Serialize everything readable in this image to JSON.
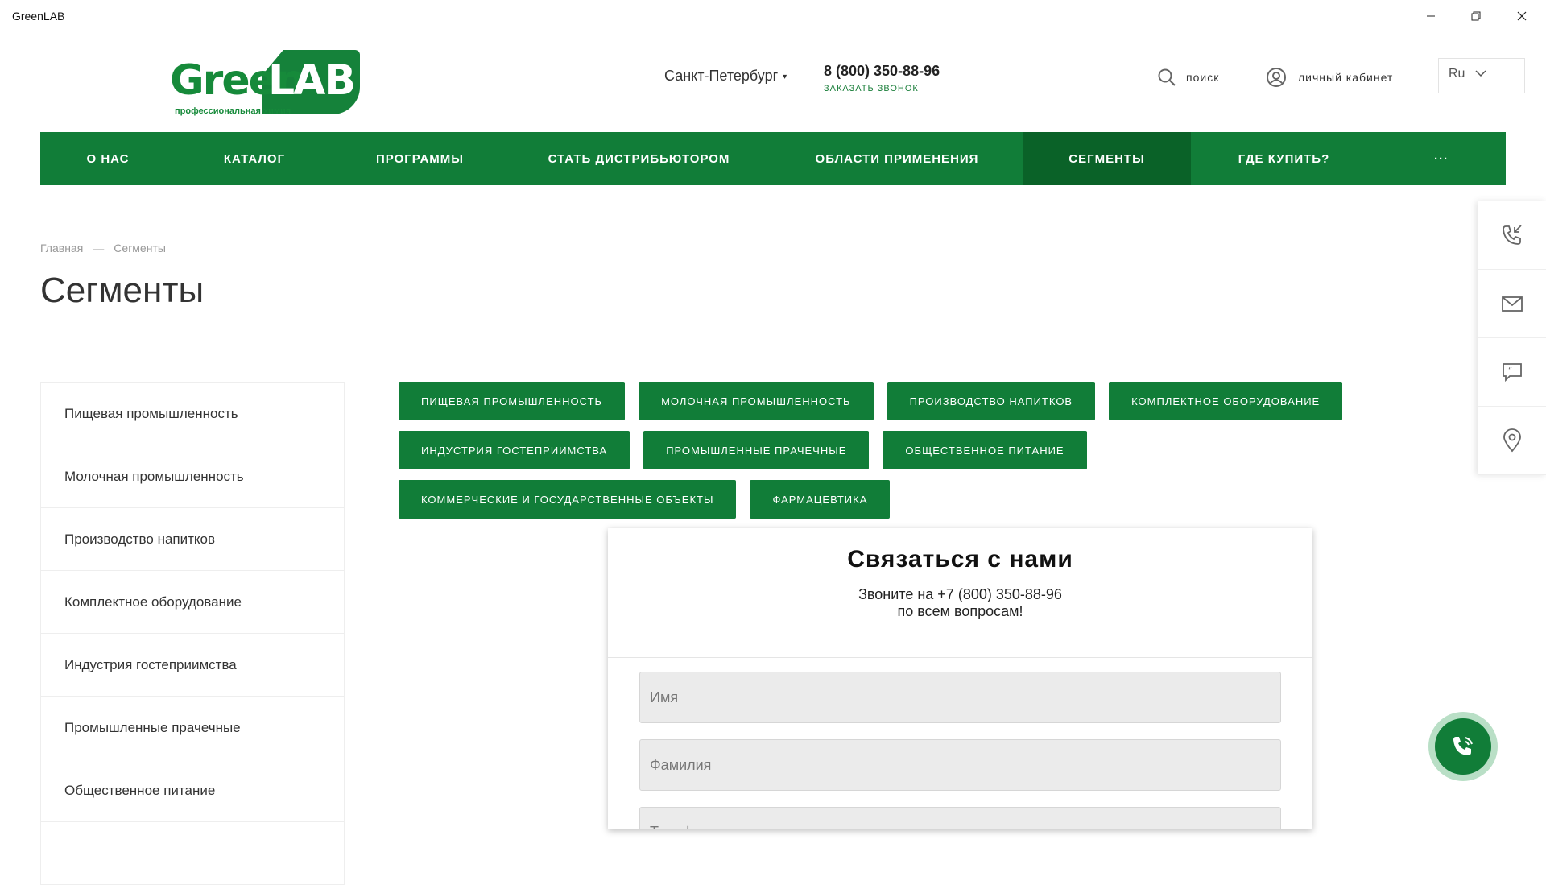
{
  "window": {
    "title": "GreenLAB"
  },
  "header": {
    "logo_green": "Green",
    "logo_lab": "LAB",
    "logo_tagline": "профессиональная химия",
    "city": "Санкт-Петербург",
    "phone": "8 (800) 350-88-96",
    "callback": "заказать звонок",
    "search_label": "поиск",
    "account_label": "личный кабинет",
    "language": "Ru"
  },
  "nav": {
    "items": [
      {
        "label": "О нас"
      },
      {
        "label": "Каталог"
      },
      {
        "label": "Программы"
      },
      {
        "label": "Стать дистрибьютором"
      },
      {
        "label": "Области применения"
      },
      {
        "label": "Сегменты"
      },
      {
        "label": "Где купить?"
      },
      {
        "label": "···"
      }
    ]
  },
  "breadcrumb": {
    "home": "Главная",
    "separator": "—",
    "current": "Сегменты"
  },
  "page_title": "Сегменты",
  "sidebar": {
    "items": [
      "Пищевая промышленность",
      "Молочная промышленность",
      "Производство напитков",
      "Комплектное оборудование",
      "Индустрия гостеприимства",
      "Промышленные прачечные",
      "Общественное питание"
    ]
  },
  "segment_tags": [
    "Пищевая промышленность",
    "Молочная промышленность",
    "Производство напитков",
    "Комплектное оборудование",
    "Индустрия гостеприимства",
    "Промышленные прачечные",
    "Общественное питание",
    "Коммерческие и государственные объекты",
    "Фармацевтика"
  ],
  "contact_form": {
    "title": "Связаться с нами",
    "subtitle_line1": "Звоните на +7 (800) 350-88-96",
    "subtitle_line2": "по всем вопросам!",
    "name_placeholder": "Имя",
    "surname_placeholder": "Фамилия",
    "phone_placeholder": "Телефон"
  },
  "colors": {
    "brand_green": "#117d38",
    "active_nav": "#0a6228"
  }
}
